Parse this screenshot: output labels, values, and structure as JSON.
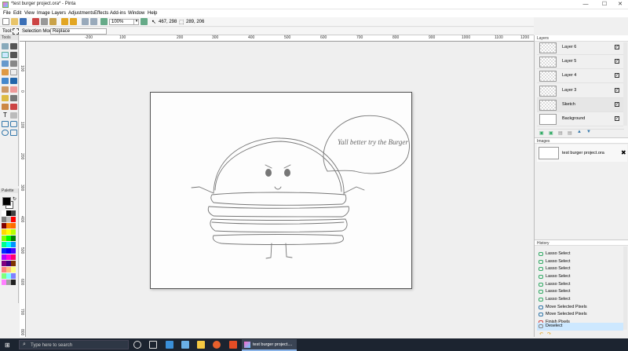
{
  "window": {
    "title": "*test burger project.ora* - Pinta",
    "minimize": "—",
    "maximize": "☐",
    "close": "✕"
  },
  "menu": [
    "File",
    "Edit",
    "View",
    "Image",
    "Layers",
    "Adjustments",
    "Effects",
    "Add-ins",
    "Window",
    "Help"
  ],
  "toolbar": {
    "zoom": "100%",
    "cursor_pos": "467, 298",
    "selection_size": "289, 206"
  },
  "tool_options": {
    "tool_label": "Tool:",
    "mode_label": "Selection Mode:",
    "mode_value": "Replace"
  },
  "panels": {
    "tools": "Tools",
    "palette": "Palette",
    "layers": "Layers",
    "images": "Images",
    "history": "History"
  },
  "ruler": {
    "top": [
      "-200",
      "100",
      "200",
      "300",
      "400",
      "500",
      "600",
      "700",
      "800",
      "900",
      "1000",
      "1100",
      "1200"
    ],
    "left": [
      "100",
      "0",
      "100",
      "200",
      "300",
      "400",
      "500",
      "600",
      "700",
      "800"
    ]
  },
  "drawing": {
    "speech": "Yall better try the Burger"
  },
  "layers": [
    {
      "name": "Layer 6",
      "visible": true
    },
    {
      "name": "Layer 5",
      "visible": true
    },
    {
      "name": "Layer 4",
      "visible": true
    },
    {
      "name": "Layer 3",
      "visible": true
    },
    {
      "name": "Sketch",
      "visible": true
    },
    {
      "name": "Background",
      "visible": true
    }
  ],
  "images": [
    {
      "name": "test burger project.ora"
    }
  ],
  "history": [
    "Lasso Select",
    "Lasso Select",
    "Lasso Select",
    "Lasso Select",
    "Lasso Select",
    "Lasso Select",
    "Lasso Select",
    "Move Selected Pixels",
    "Move Selected Pixels",
    "Finish Pixels",
    "Deselect"
  ],
  "taskbar": {
    "search": "Type here to search",
    "active_app": "test burger project...."
  },
  "colors": {
    "accent": "#cde8ff",
    "titlebar": "#ffffff",
    "taskbar": "#1c2430",
    "primary_color": "#000000",
    "secondary_color": "#ffffff"
  },
  "palette": [
    "#ffffff",
    "#000000",
    "#404040",
    "#808080",
    "#c0c0c0",
    "#ff0000",
    "#800000",
    "#ff8000",
    "#ff6a00",
    "#ffd800",
    "#ffff00",
    "#b6ff00",
    "#80ff00",
    "#00ff00",
    "#008000",
    "#00ff90",
    "#00ffff",
    "#0094ff",
    "#0026ff",
    "#0000ff",
    "#4800ff",
    "#b200ff",
    "#ff00dc",
    "#ff006e",
    "#800080",
    "#400080",
    "#7f3300",
    "#ff7f7f",
    "#ffbf7f",
    "#ffff7f",
    "#7fff7f",
    "#7fffff",
    "#7f7fff",
    "#ff7fff",
    "#a0a0a0",
    "#202020"
  ]
}
